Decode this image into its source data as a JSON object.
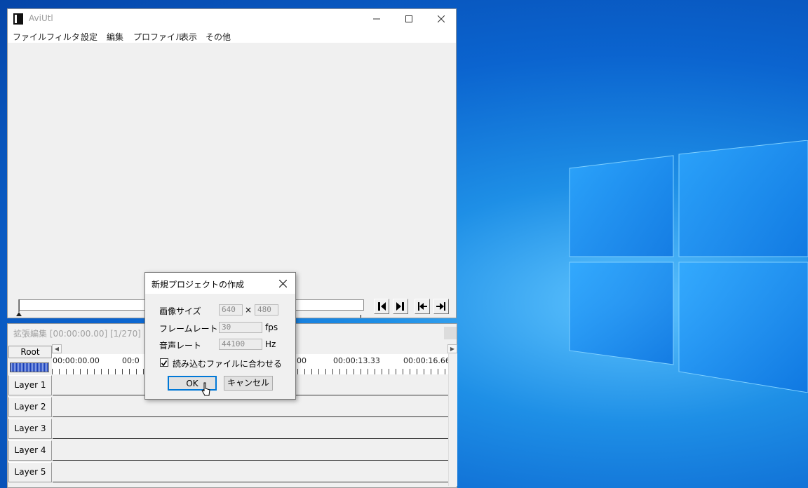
{
  "main_window": {
    "title": "AviUtl",
    "menu": [
      "ファイル",
      "フィルタ",
      "設定",
      "編集",
      "プロファイル",
      "表示",
      "その他"
    ]
  },
  "timeline": {
    "title": "拡張編集 [00:00:00.00] [1/270]",
    "root_label": "Root",
    "ruler_times": [
      "00:00:00.00",
      "00:0",
      "00",
      "00:00:13.33",
      "00:00:16.66"
    ],
    "layers": [
      "Layer 1",
      "Layer 2",
      "Layer 3",
      "Layer 4",
      "Layer 5"
    ]
  },
  "dialog": {
    "title": "新規プロジェクトの作成",
    "image_size_label": "画像サイズ",
    "width": "640",
    "times": "×",
    "height": "480",
    "frame_rate_label": "フレームレート",
    "frame_rate": "30",
    "frame_rate_unit": "fps",
    "audio_rate_label": "音声レート",
    "audio_rate": "44100",
    "audio_rate_unit": "Hz",
    "match_file_label": "読み込むファイルに合わせる",
    "match_file_checked": true,
    "ok_label": "OK",
    "cancel_label": "キャンセル"
  },
  "icons": [
    "app-icon",
    "minimize-icon",
    "maximize-icon",
    "close-icon",
    "prev-keyframe-icon",
    "next-keyframe-icon",
    "go-start-icon",
    "go-end-icon",
    "checkmark-icon",
    "mouse-cursor-icon",
    "windows-logo"
  ]
}
